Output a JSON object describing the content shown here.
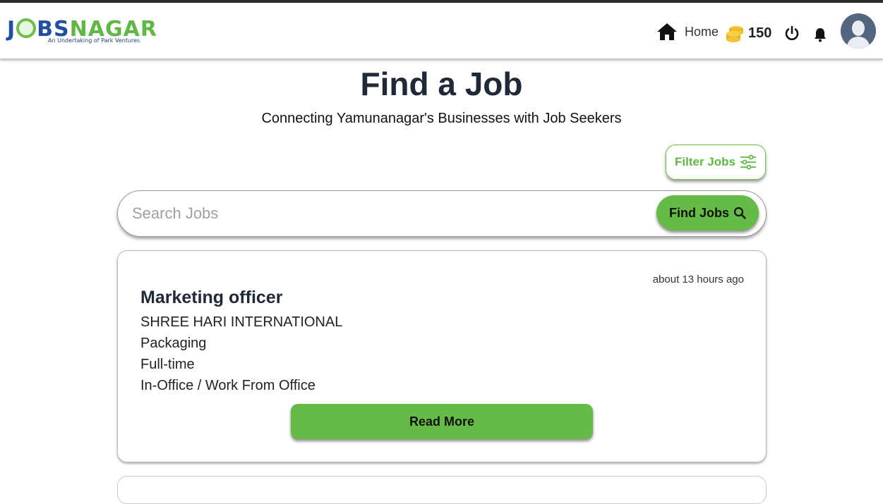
{
  "brand": {
    "logo_text_j": "J",
    "logo_text_bs": "BS",
    "logo_text_nagar": "NAGAR",
    "tagline": "An Undertaking of Park Ventures"
  },
  "nav": {
    "home_label": "Home",
    "coin_count": "150"
  },
  "page": {
    "title": "Find a Job",
    "subtitle": "Connecting Yamunanagar's Businesses with Job Seekers"
  },
  "filter": {
    "label": "Filter Jobs"
  },
  "search": {
    "placeholder": "Search Jobs",
    "value": "",
    "button_label": "Find Jobs"
  },
  "jobs": [
    {
      "posted": "about 13 hours ago",
      "title": "Marketing officer",
      "company": "SHREE HARI INTERNATIONAL",
      "category": "Packaging",
      "type": "Full-time",
      "location": "In-Office / Work From Office",
      "button_label": "Read More"
    }
  ],
  "colors": {
    "accent_green": "#66bb46",
    "brand_blue": "#1f4fa0",
    "text_dark": "#1f2937"
  }
}
